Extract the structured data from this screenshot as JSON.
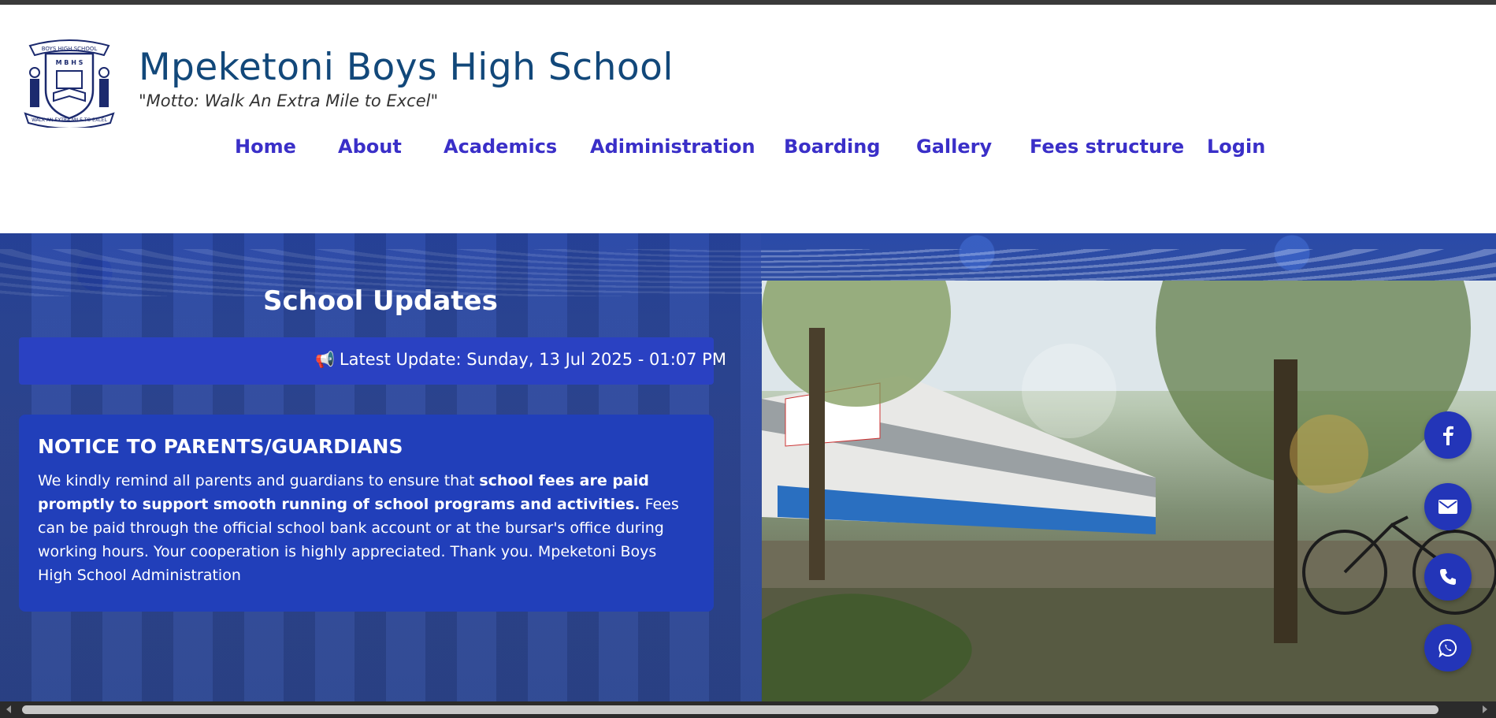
{
  "header": {
    "school_name": "Mpeketoni Boys High School",
    "motto": "\"Motto: Walk An Extra Mile to Excel\"",
    "logo_text_top": "BOYS HIGH SCHOOL",
    "logo_initials": "M B H S",
    "logo_text_bottom": "WALK AN EXTRA MILE TO EXCEL"
  },
  "nav": {
    "items": [
      {
        "label": "Home"
      },
      {
        "label": "About"
      },
      {
        "label": "Academics"
      },
      {
        "label": "Adiministration"
      },
      {
        "label": "Boarding"
      },
      {
        "label": "Gallery"
      },
      {
        "label": "Fees structure"
      },
      {
        "label": "Login"
      }
    ]
  },
  "updates": {
    "title": "School Updates",
    "latest_label": "Latest Update: Sunday, 13 Jul 2025 - 01:07 PM",
    "latest_icon": "megaphone-icon"
  },
  "notice": {
    "title": "NOTICE TO PARENTS/GUARDIANS",
    "body_intro": "We kindly remind all parents and guardians to ensure that ",
    "body_bold": "school fees are paid promptly to support smooth running of school programs and activities.",
    "body_rest": " Fees can be paid through the official school bank account or at the bursar's office during working hours. Your cooperation is highly appreciated. Thank you.  Mpeketoni Boys High School Administration"
  },
  "social": {
    "icons": [
      "facebook-icon",
      "email-icon",
      "phone-icon",
      "whatsapp-icon"
    ]
  },
  "colors": {
    "brand_blue": "#12487a",
    "nav_blue": "#3a2fc8",
    "card_blue": "#213fba",
    "social_blue": "#2335b8"
  }
}
